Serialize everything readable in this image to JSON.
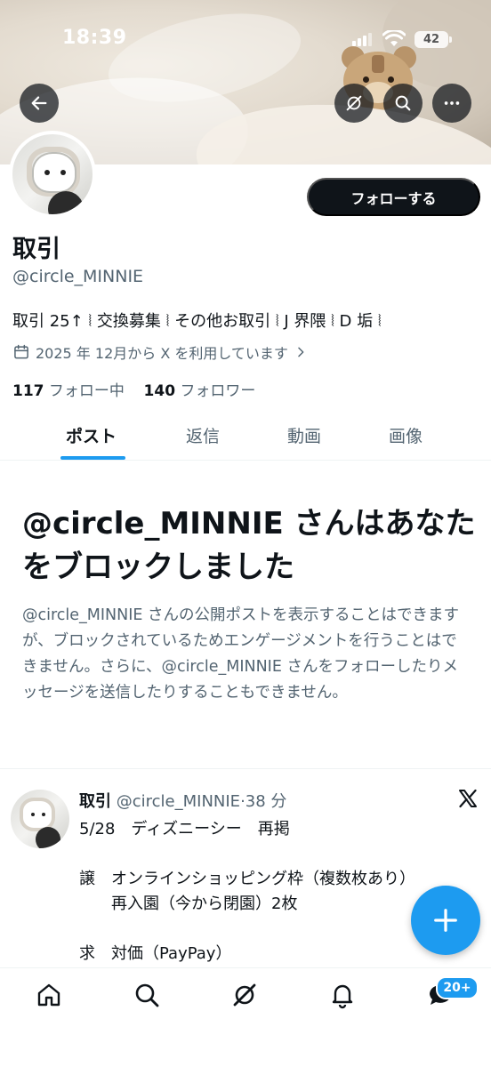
{
  "status_bar": {
    "time": "18:39",
    "battery": "42"
  },
  "profile": {
    "display_name": "取引",
    "handle": "@circle_MINNIE",
    "bio": "取引 25↑ ⦚ 交換募集 ⦚ その他お取引 ⦚ J 界隈 ⦚ D 垢 ⦚",
    "joined": "2025 年 12月から X を利用しています",
    "following_count": "117",
    "following_label": "フォロー中",
    "followers_count": "140",
    "followers_label": "フォロワー",
    "follow_button": "フォローする"
  },
  "tabs": [
    {
      "label": "ポスト",
      "active": true
    },
    {
      "label": "返信",
      "active": false
    },
    {
      "label": "動画",
      "active": false
    },
    {
      "label": "画像",
      "active": false
    }
  ],
  "blocked_notice": {
    "title": "@circle_MINNIE さんはあなたをブロックしました",
    "description": "@circle_MINNIE さんの公開ポストを表示することはできますが、ブロックされているためエンゲージメントを行うことはできません。さらに、@circle_MINNIE さんをフォローしたりメッセージを送信したりすることもできません。"
  },
  "post": {
    "name": "取引",
    "handle": "@circle_MINNIE",
    "separator": "·",
    "time": "38 分",
    "lines": [
      "5/28　ディズニーシー　再掲",
      "譲　オンラインショッピング枠（複数枚あり）",
      "　　再入園（今から閉園）2枚",
      "求　対価（PayPay）"
    ]
  },
  "bottom_nav": {
    "messages_badge": "20+"
  },
  "colors": {
    "accent": "#1d9bf0",
    "text": "#0f1419",
    "secondary": "#536471"
  },
  "icons": [
    "back-arrow-icon",
    "grok-icon",
    "search-icon",
    "more-icon",
    "calendar-icon",
    "chevron-right-icon",
    "x-logo-icon",
    "plus-icon",
    "home-icon",
    "grok-icon",
    "bell-icon",
    "messages-icon"
  ]
}
